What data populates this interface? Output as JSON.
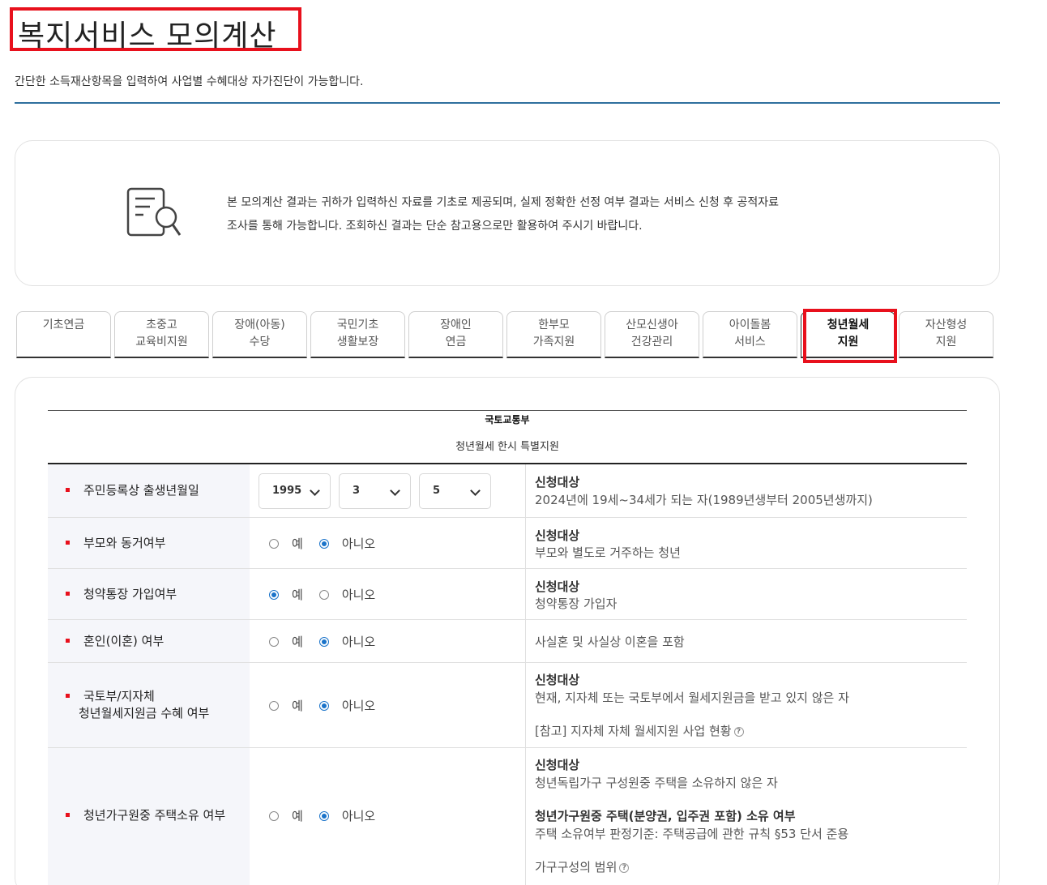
{
  "header": {
    "title": "복지서비스 모의계산",
    "subtitle": "간단한 소득재산항목을 입력하여 사업별 수혜대상 자가진단이 가능합니다."
  },
  "notice": {
    "icon": "document-search-icon",
    "line1": "본 모의계산 결과는 귀하가 입력하신 자료를 기초로 제공되며, 실제 정확한 선정 여부 결과는 서비스 신청 후 공적자료",
    "line2": "조사를 통해 가능합니다. 조회하신 결과는 단순 참고용으로만 활용하여 주시기 바랍니다."
  },
  "tabs": [
    {
      "line1": "기초연금",
      "line2": ""
    },
    {
      "line1": "초중고",
      "line2": "교육비지원"
    },
    {
      "line1": "장애(아동)",
      "line2": "수당"
    },
    {
      "line1": "국민기초",
      "line2": "생활보장"
    },
    {
      "line1": "장애인",
      "line2": "연금"
    },
    {
      "line1": "한부모",
      "line2": "가족지원"
    },
    {
      "line1": "산모신생아",
      "line2": "건강관리"
    },
    {
      "line1": "아이돌봄",
      "line2": "서비스"
    },
    {
      "line1": "청년월세",
      "line2": "지원"
    },
    {
      "line1": "자산형성",
      "line2": "지원"
    }
  ],
  "active_tab_index": 8,
  "table": {
    "ministry": "국토교통부",
    "program": "청년월세 한시 특별지원",
    "radio_yes": "예",
    "radio_no": "아니오",
    "rows": [
      {
        "label": "주민등록상 출생년월일",
        "birth_year": "1995",
        "birth_month": "3",
        "birth_day": "5",
        "info_title": "신청대상",
        "info_desc": "2024년에 19세~34세가 되는 자(1989년생부터 2005년생까지)"
      },
      {
        "label": "부모와 동거여부",
        "selected": "아니오",
        "info_title": "신청대상",
        "info_desc": "부모와 별도로 거주하는 청년"
      },
      {
        "label": "청약통장 가입여부",
        "selected": "예",
        "info_title": "신청대상",
        "info_desc": "청약통장 가입자"
      },
      {
        "label": "혼인(이혼) 여부",
        "selected": "아니오",
        "info_desc": "사실혼 및 사실상 이혼을 포함"
      },
      {
        "label_line1": "국토부/지자체",
        "label_line2": "청년월세지원금 수혜 여부",
        "selected": "아니오",
        "info_title": "신청대상",
        "info_desc": "현재, 지자체 또는 국토부에서 월세지원금을 받고 있지 않은 자",
        "info_link": "[참고] 지자체 자체 월세지원 사업 현황"
      },
      {
        "label": "청년가구원중 주택소유 여부",
        "selected": "아니오",
        "info_title": "신청대상",
        "info_desc": "청년독립가구 구성원중 주택을 소유하지 않은 자",
        "info_title2": "청년가구원중 주택(분양권, 입주권 포함) 소유 여부",
        "info_desc2": "주택 소유여부 판정기준: 주택공급에 관한 규칙 §53 단서 준용",
        "info_link": "가구구성의 범위"
      }
    ]
  },
  "help_glyph": "?",
  "colors": {
    "highlight": "#e8101c",
    "accent_blue": "#1a73c9",
    "rule_blue": "#2f6f9e"
  }
}
